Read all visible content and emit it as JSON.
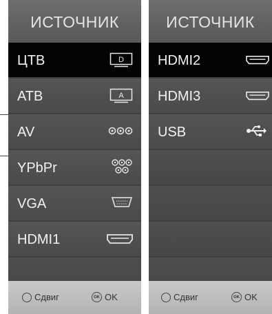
{
  "left_panel": {
    "title": "ИСТОЧНИК",
    "items": [
      {
        "label": "ЦТВ",
        "icon": "tv-d-icon",
        "icon_text": "D",
        "selected": true
      },
      {
        "label": "АТВ",
        "icon": "tv-a-icon",
        "icon_text": "A",
        "selected": false
      },
      {
        "label": "AV",
        "icon": "av-jacks-icon",
        "selected": false
      },
      {
        "label": "YPbPr",
        "icon": "component-jacks-icon",
        "selected": false
      },
      {
        "label": "VGA",
        "icon": "vga-port-icon",
        "selected": false
      },
      {
        "label": "HDMI1",
        "icon": "hdmi-port-icon",
        "selected": false
      }
    ],
    "footer": {
      "move_label": "Сдвиг",
      "ok_label": "OK",
      "ok_icon_text": "OK"
    }
  },
  "right_panel": {
    "title": "ИСТОЧНИК",
    "items": [
      {
        "label": "HDMI2",
        "icon": "hdmi-port-icon",
        "selected": true
      },
      {
        "label": "HDMI3",
        "icon": "hdmi-port-icon",
        "selected": false
      },
      {
        "label": "USB",
        "icon": "usb-icon",
        "selected": false
      }
    ],
    "footer": {
      "move_label": "Сдвиг",
      "ok_label": "OK",
      "ok_icon_text": "OK"
    }
  },
  "colors": {
    "selected_bg": "#030303",
    "panel_bg": "#555555",
    "footer_bg": "#c0c0c0",
    "text": "#f2f2f2"
  }
}
